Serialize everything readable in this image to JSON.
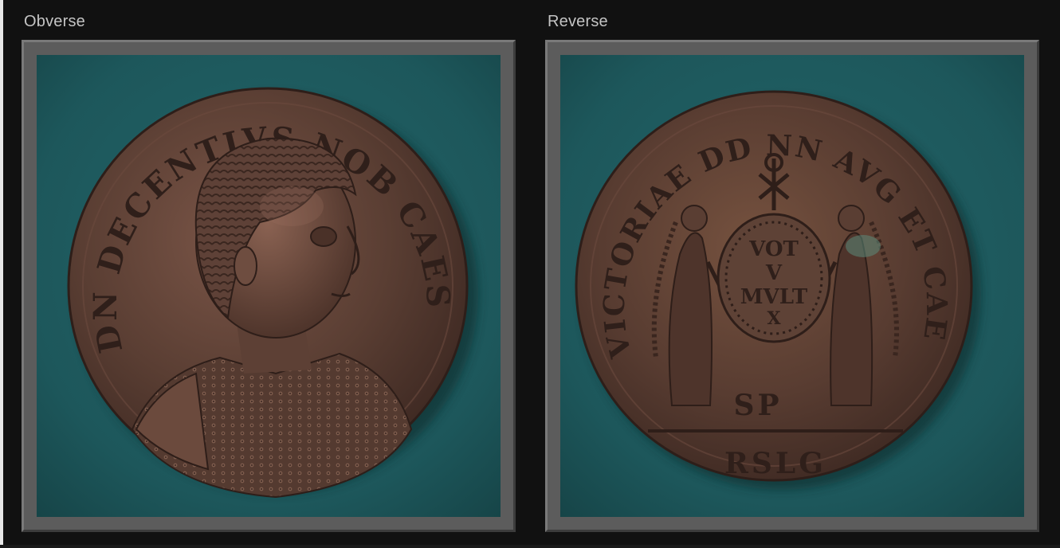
{
  "panels": {
    "obverse": {
      "label": "Obverse"
    },
    "reverse": {
      "label": "Reverse"
    }
  },
  "colors": {
    "background": "#111111",
    "label_text": "#c4c4c4",
    "frame": "#5c5c5c",
    "felt": "#1f5a5e",
    "bronze": "#5a3e33"
  },
  "coin_legends": {
    "obverse": "DN DECENTIVS NOB CAES",
    "reverse_legend": "VICTORIAE DD NN AVG ET CAE",
    "reverse_vow": "VOT V MVLT X",
    "reverse_field": "SP",
    "reverse_exergue": "RSLG"
  }
}
